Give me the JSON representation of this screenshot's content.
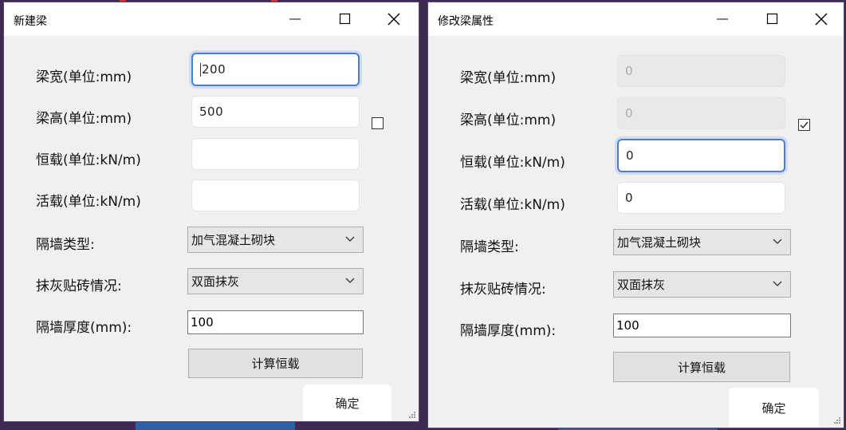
{
  "new_beam": {
    "title": "新建梁",
    "fields": {
      "width_label": "梁宽(单位:mm)",
      "width_value": "200",
      "height_label": "梁高(单位:mm)",
      "height_value": "500",
      "dead_label": "恒载(单位:kN/m)",
      "dead_value": "",
      "live_label": "活载(单位:kN/m)",
      "live_value": ""
    },
    "checkbox_checked": false,
    "wall_type_label": "隔墙类型:",
    "wall_type_value": "加气混凝土砌块",
    "plaster_label": "抹灰贴砖情况:",
    "plaster_value": "双面抹灰",
    "thickness_label": "隔墙厚度(mm):",
    "thickness_value": "100",
    "calc_button": "计算恒载",
    "ok_button": "确定"
  },
  "edit_beam": {
    "title": "修改梁属性",
    "fields": {
      "width_label": "梁宽(单位:mm)",
      "width_value": "0",
      "height_label": "梁高(单位:mm)",
      "height_value": "0",
      "dead_label": "恒载(单位:kN/m)",
      "dead_value": "0",
      "live_label": "活载(单位:kN/m)",
      "live_value": "0"
    },
    "checkbox_checked": true,
    "wall_type_label": "隔墙类型:",
    "wall_type_value": "加气混凝土砌块",
    "plaster_label": "抹灰贴砖情况:",
    "plaster_value": "双面抹灰",
    "thickness_label": "隔墙厚度(mm):",
    "thickness_value": "100",
    "calc_button": "计算恒载",
    "ok_button": "确定"
  },
  "icons": {
    "minimize": "minimize-icon",
    "maximize": "maximize-icon",
    "close": "close-icon",
    "dropdown": "chevron-down-icon",
    "checkmark": "checkmark-icon",
    "resize": "resize-grip-icon"
  },
  "colors": {
    "dialog_background": "#f0f0f0",
    "focus_border": "#4a7fd4",
    "desktop_background": "#3d2a55"
  }
}
